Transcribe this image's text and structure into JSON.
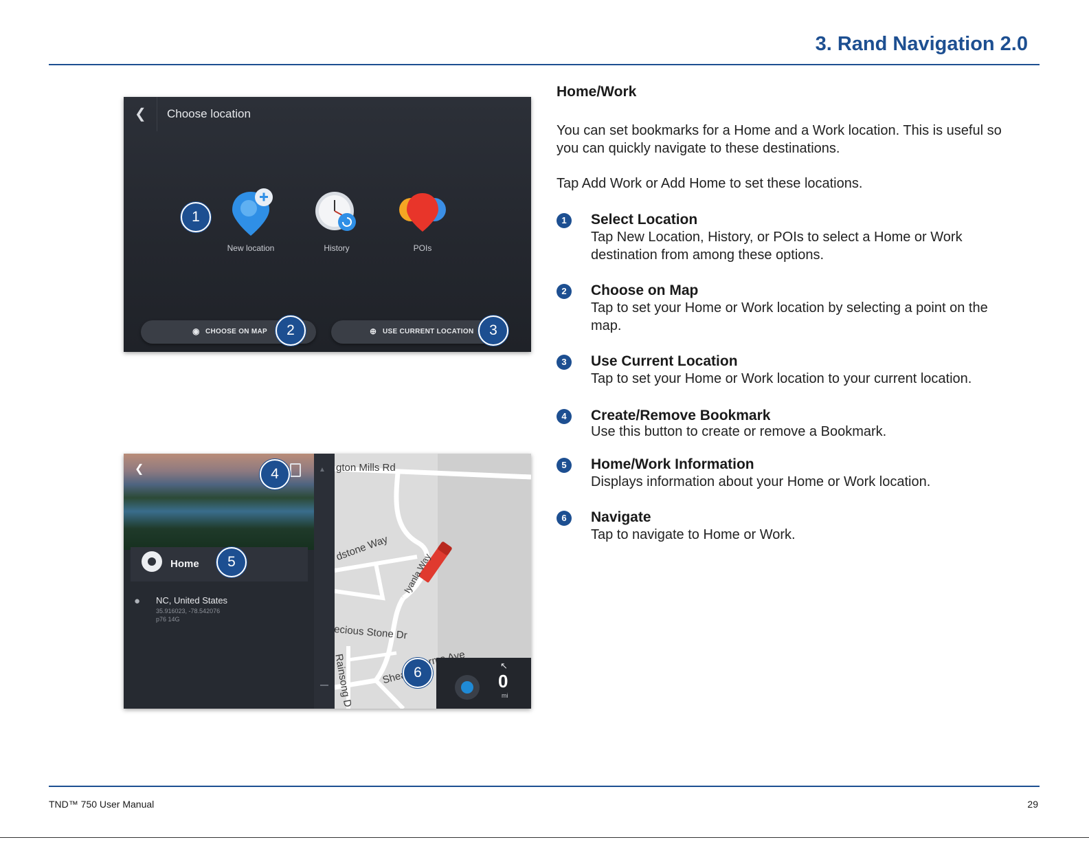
{
  "header": {
    "chapter_title": "3. Rand Navigation 2.0"
  },
  "screen_choose_location": {
    "back_icon": "chevron-left-icon",
    "title": "Choose location",
    "options": [
      {
        "label": "New location",
        "icon": "new-location-pin-icon"
      },
      {
        "label": "History",
        "icon": "history-clock-icon"
      },
      {
        "label": "POIs",
        "icon": "poi-balloons-icon"
      }
    ],
    "choose_on_map_label": "CHOOSE ON MAP",
    "use_current_location_label": "USE CURRENT LOCATION"
  },
  "screen_home": {
    "home_label": "Home",
    "location_title": "NC, United States",
    "coordinates": "35.916023, -78.542076",
    "code": "p76 14G",
    "streets": [
      "gton Mills Rd",
      "dstone Way",
      "Iyanla Way",
      "ecious Stone Dr",
      "Rainsong D",
      "Shea",
      "rms Ave"
    ],
    "distance_value": "0",
    "distance_unit": "mi"
  },
  "callouts": [
    "1",
    "2",
    "3",
    "4",
    "5",
    "6"
  ],
  "content": {
    "section_heading": "Home/Work",
    "intro_line1": "You can set bookmarks for a Home and a Work location. This is useful so",
    "intro_line2": "you can quickly navigate to these destinations.",
    "intro_instruction": "Tap Add Work or Add Home to set these locations.",
    "items": [
      {
        "num": "1",
        "title": "Select Location",
        "desc_line1": "Tap New Location, History, or POIs to select a Home or Work",
        "desc_line2": "destination from among these options."
      },
      {
        "num": "2",
        "title": "Choose on Map",
        "desc_line1": "Tap to set your Home or Work location by selecting a point on the",
        "desc_line2": "map."
      },
      {
        "num": "3",
        "title": "Use Current Location",
        "desc_line1": "Tap to set your Home or Work location to your current location.",
        "desc_line2": ""
      },
      {
        "num": "4",
        "title": "Create/Remove Bookmark",
        "desc_line1": "Use this button to create or remove a Bookmark.",
        "desc_line2": ""
      },
      {
        "num": "5",
        "title": "Home/Work Information",
        "desc_line1": "Displays information about your Home or Work location.",
        "desc_line2": ""
      },
      {
        "num": "6",
        "title": "Navigate",
        "desc_line1": "Tap to navigate to Home or Work.",
        "desc_line2": ""
      }
    ]
  },
  "footer": {
    "manual_title": "TND™ 750 User Manual",
    "page_number": "29"
  },
  "colors": {
    "accent_blue": "#1d4f91",
    "screen_dark": "#262a31",
    "map_gray": "#dcdcdc",
    "truck_red": "#e03a2f"
  }
}
